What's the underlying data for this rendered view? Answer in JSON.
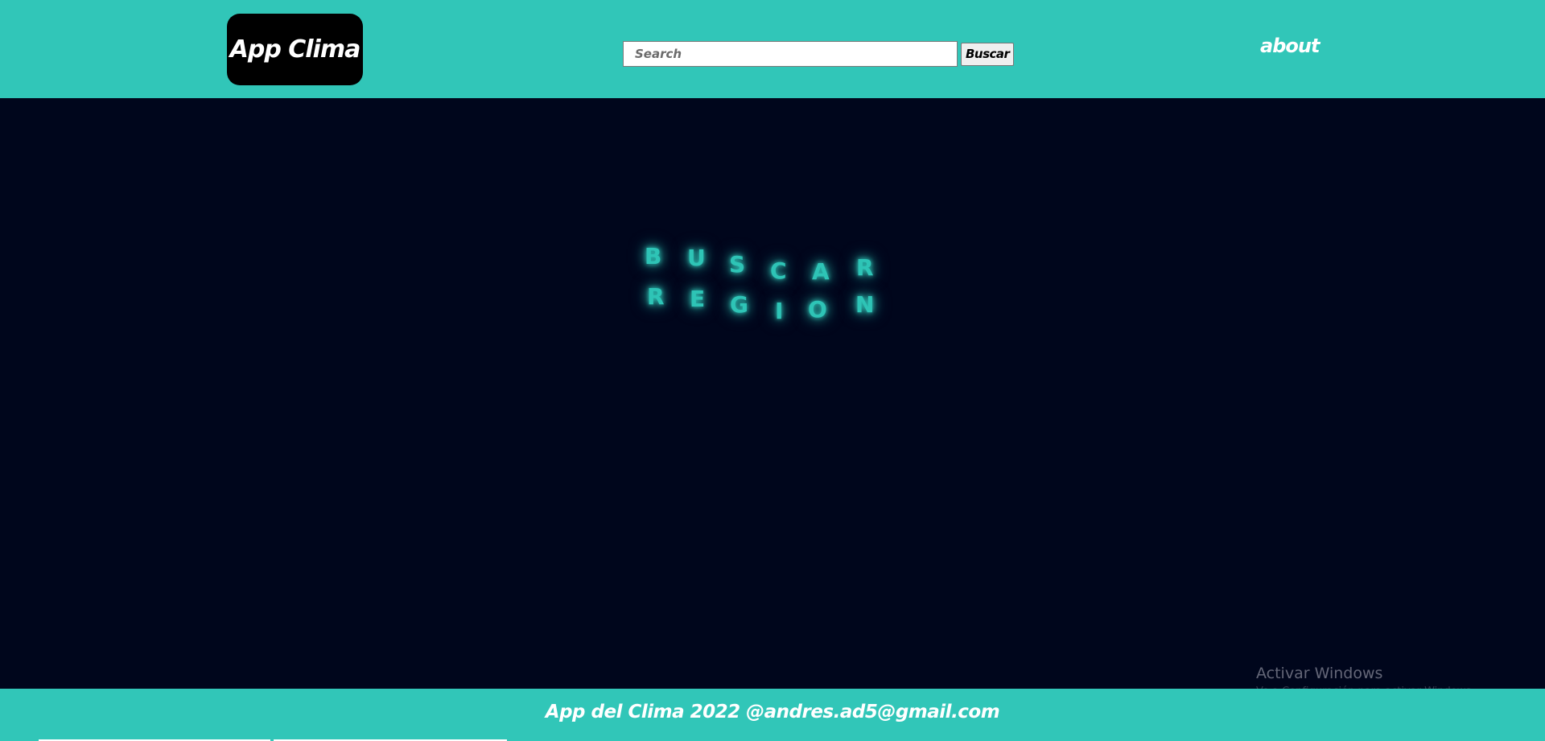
{
  "header": {
    "logo_text": "App Clima",
    "search": {
      "placeholder": "Search",
      "value": "",
      "button_label": "Buscar"
    },
    "about_label": "about"
  },
  "main": {
    "hero_words": [
      "BUSCAR",
      "REGION"
    ],
    "hero_letters_row1": [
      "B",
      "U",
      "S",
      "C",
      "A",
      "R"
    ],
    "hero_letters_row2": [
      "R",
      "E",
      "G",
      "I",
      "O",
      "N"
    ]
  },
  "footer": {
    "text": "App del Clima 2022 @andres.ad5@gmail.com"
  },
  "system_watermark": {
    "title": "Activar Windows",
    "subtitle": "Ve a Configuración para activar Windows."
  },
  "colors": {
    "accent": "#31c6b8",
    "background": "#00061c",
    "glow": "#2ec4b6"
  }
}
